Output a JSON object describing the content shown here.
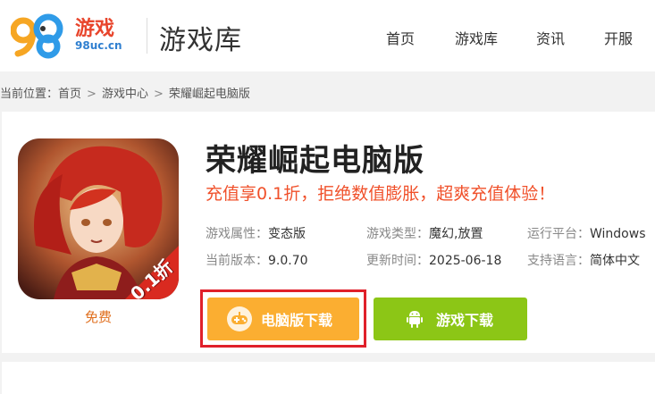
{
  "header": {
    "logo_text": "游戏",
    "logo_domain": "98uc.cn",
    "site_title": "游戏库",
    "nav": [
      "首页",
      "游戏库",
      "资讯",
      "开服"
    ]
  },
  "breadcrumb": {
    "label": "当前位置：",
    "items": [
      "首页",
      "游戏中心",
      "荣耀崛起电脑版"
    ],
    "separator": ">"
  },
  "game": {
    "title": "荣耀崛起电脑版",
    "slogan": "充值享0.1折，拒绝数值膨胀，超爽充值体验！",
    "price": "免费",
    "badge": "0.1折",
    "info": [
      {
        "key": "游戏属性：",
        "value": "变态版"
      },
      {
        "key": "游戏类型：",
        "value": "魔幻,放置"
      },
      {
        "key": "运行平台：",
        "value": "Windows"
      },
      {
        "key": "当前版本：",
        "value": "9.0.70"
      },
      {
        "key": "更新时间：",
        "value": "2025-06-18"
      },
      {
        "key": "支持语言：",
        "value": "简体中文"
      }
    ]
  },
  "buttons": {
    "pc_download": "电脑版下载",
    "game_download": "游戏下载"
  },
  "colors": {
    "accent_orange": "#fbae31",
    "accent_green": "#8cc616",
    "slogan_red": "#f0502a",
    "highlight_red": "#e0202a"
  }
}
